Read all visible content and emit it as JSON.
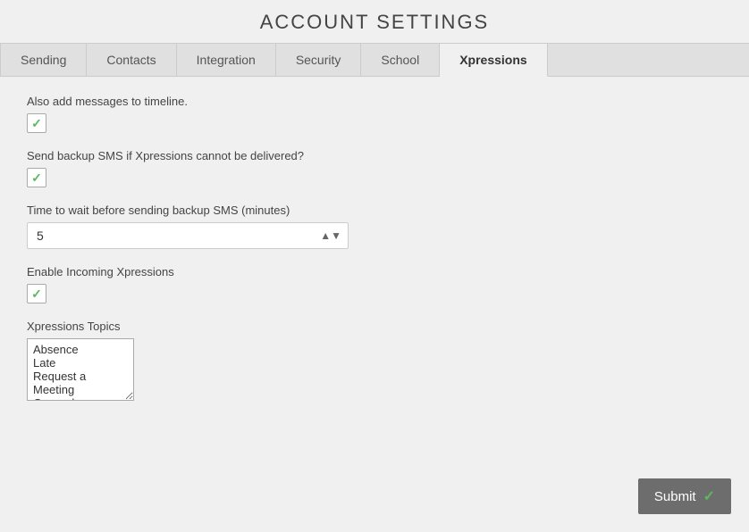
{
  "header": {
    "title": "ACCOUNT SETTINGS"
  },
  "tabs": [
    {
      "label": "Sending",
      "active": false
    },
    {
      "label": "Contacts",
      "active": false
    },
    {
      "label": "Integration",
      "active": false
    },
    {
      "label": "Security",
      "active": false
    },
    {
      "label": "School",
      "active": false
    },
    {
      "label": "Xpressions",
      "active": true
    }
  ],
  "form": {
    "timeline_label": "Also add messages to timeline.",
    "timeline_checked": true,
    "backup_sms_label": "Send backup SMS if Xpressions cannot be delivered?",
    "backup_sms_checked": true,
    "wait_time_label": "Time to wait before sending backup SMS (minutes)",
    "wait_time_value": "5",
    "incoming_label": "Enable Incoming Xpressions",
    "incoming_checked": true,
    "topics_label": "Xpressions Topics",
    "topics_value": "Absence\nLate\nRequest a Meeting\nGeneral\nPastoral Care"
  },
  "submit_button": {
    "label": "Submit"
  }
}
